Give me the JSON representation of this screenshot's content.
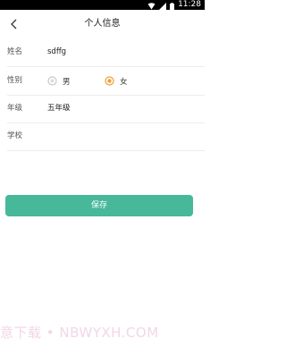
{
  "status_bar": {
    "time": "11:28",
    "icons": [
      "wifi-icon",
      "signal-icon",
      "battery-icon"
    ]
  },
  "header": {
    "title": "个人信息",
    "back_icon": "chevron-left-icon"
  },
  "form": {
    "name": {
      "label": "姓名",
      "value": "sdffg"
    },
    "gender": {
      "label": "性别",
      "options": [
        {
          "label": "男",
          "selected": false
        },
        {
          "label": "女",
          "selected": true
        }
      ]
    },
    "grade": {
      "label": "年级",
      "value": "五年级"
    },
    "school": {
      "label": "学校",
      "value": ""
    }
  },
  "save_button": {
    "label": "保存"
  },
  "watermark": {
    "text": "意下载 • NBWYXH.COM"
  },
  "colors": {
    "accent": "#47b89a",
    "radio_selected": "#f0a030",
    "radio_unselected": "#c8c8c8"
  }
}
